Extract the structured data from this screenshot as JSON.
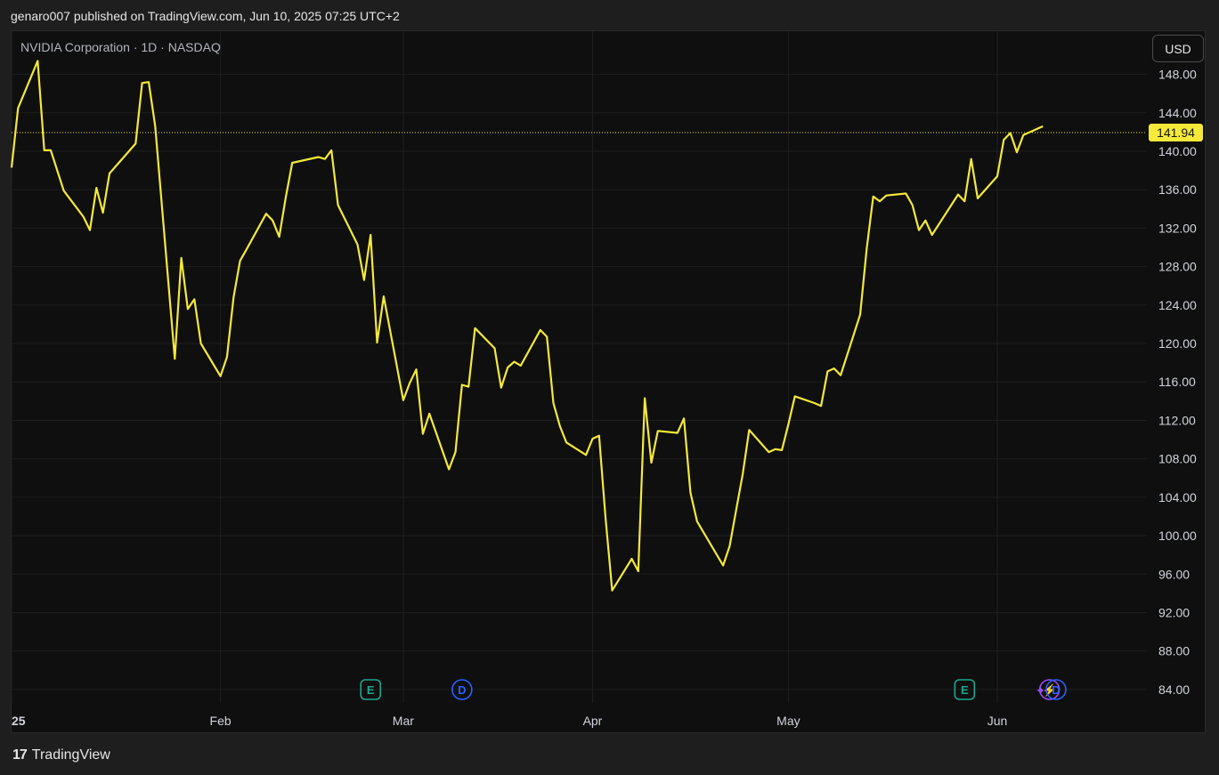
{
  "header": {
    "text": "genaro007 published on TradingView.com, Jun 10, 2025 07:25 UTC+2"
  },
  "symbol": {
    "text": "NVIDIA Corporation · 1D · NASDAQ"
  },
  "currency_button": {
    "label": "USD"
  },
  "footer": {
    "brand": "TradingView",
    "logo_glyph": "17"
  },
  "colors": {
    "line": "#f5e93a",
    "grid": "#1f1f1f",
    "background": "#0f0f0f",
    "axis_text": "#d1d4dc",
    "earnings": "#1fa68f",
    "dividend": "#2962ff",
    "split": "#9c4dff"
  },
  "chart_data": {
    "type": "line",
    "title": "",
    "xlabel": "",
    "ylabel": "",
    "ylim": [
      82.6,
      152.5
    ],
    "y_ticks": [
      84,
      88,
      92,
      96,
      100,
      104,
      108,
      112,
      116,
      120,
      124,
      128,
      132,
      136,
      140,
      144,
      148
    ],
    "y_tick_labels": [
      "84.00",
      "88.00",
      "92.00",
      "96.00",
      "100.00",
      "104.00",
      "108.00",
      "112.00",
      "116.00",
      "120.00",
      "124.00",
      "128.00",
      "132.00",
      "136.00",
      "140.00",
      "144.00",
      "148.00"
    ],
    "x_labels": [
      {
        "label": "25",
        "date": "2025-01-02"
      },
      {
        "label": "Feb",
        "date": "2025-02-03"
      },
      {
        "label": "Mar",
        "date": "2025-03-03"
      },
      {
        "label": "Apr",
        "date": "2025-04-01"
      },
      {
        "label": "May",
        "date": "2025-05-01"
      },
      {
        "label": "Jun",
        "date": "2025-06-02"
      }
    ],
    "last_price": 141.94,
    "last_price_label": "141.94",
    "series": [
      {
        "x": [
          "2025-01-02",
          "2025-01-03",
          "2025-01-06",
          "2025-01-07",
          "2025-01-08",
          "2025-01-10",
          "2025-01-13",
          "2025-01-14",
          "2025-01-15",
          "2025-01-16",
          "2025-01-17",
          "2025-01-21",
          "2025-01-22",
          "2025-01-23",
          "2025-01-24",
          "2025-01-27",
          "2025-01-28",
          "2025-01-29",
          "2025-01-30",
          "2025-01-31",
          "2025-02-03",
          "2025-02-04",
          "2025-02-05",
          "2025-02-06",
          "2025-02-07",
          "2025-02-10",
          "2025-02-11",
          "2025-02-12",
          "2025-02-13",
          "2025-02-14",
          "2025-02-18",
          "2025-02-19",
          "2025-02-20",
          "2025-02-21",
          "2025-02-24",
          "2025-02-25",
          "2025-02-26",
          "2025-02-27",
          "2025-02-28",
          "2025-03-03",
          "2025-03-04",
          "2025-03-05",
          "2025-03-06",
          "2025-03-07",
          "2025-03-10",
          "2025-03-11",
          "2025-03-12",
          "2025-03-13",
          "2025-03-14",
          "2025-03-17",
          "2025-03-18",
          "2025-03-19",
          "2025-03-20",
          "2025-03-21",
          "2025-03-24",
          "2025-03-25",
          "2025-03-26",
          "2025-03-27",
          "2025-03-28",
          "2025-03-31",
          "2025-04-01",
          "2025-04-02",
          "2025-04-03",
          "2025-04-04",
          "2025-04-07",
          "2025-04-08",
          "2025-04-09",
          "2025-04-10",
          "2025-04-11",
          "2025-04-14",
          "2025-04-15",
          "2025-04-16",
          "2025-04-17",
          "2025-04-21",
          "2025-04-22",
          "2025-04-23",
          "2025-04-24",
          "2025-04-25",
          "2025-04-28",
          "2025-04-29",
          "2025-04-30",
          "2025-05-01",
          "2025-05-02",
          "2025-05-05",
          "2025-05-06",
          "2025-05-07",
          "2025-05-08",
          "2025-05-09",
          "2025-05-12",
          "2025-05-13",
          "2025-05-14",
          "2025-05-15",
          "2025-05-16",
          "2025-05-19",
          "2025-05-20",
          "2025-05-21",
          "2025-05-22",
          "2025-05-23",
          "2025-05-27",
          "2025-05-28",
          "2025-05-29",
          "2025-05-30",
          "2025-06-02",
          "2025-06-03",
          "2025-06-04",
          "2025-06-05",
          "2025-06-06",
          "2025-06-09"
        ],
        "values": [
          138.3,
          144.5,
          149.4,
          140.1,
          140.1,
          135.9,
          133.2,
          131.8,
          136.2,
          133.6,
          137.7,
          140.8,
          147.1,
          147.2,
          142.6,
          118.4,
          128.9,
          123.6,
          124.6,
          120.0,
          116.6,
          118.6,
          124.8,
          128.6,
          129.8,
          133.5,
          132.8,
          131.1,
          135.2,
          138.8,
          139.4,
          139.2,
          140.1,
          134.4,
          130.3,
          126.6,
          131.3,
          120.1,
          124.9,
          114.1,
          115.9,
          117.3,
          110.6,
          112.7,
          106.9,
          108.7,
          115.7,
          115.5,
          121.6,
          119.5,
          115.4,
          117.5,
          118.1,
          117.7,
          121.4,
          120.7,
          113.8,
          111.4,
          109.7,
          108.4,
          110.1,
          110.4,
          101.8,
          94.3,
          97.6,
          96.3,
          114.3,
          107.6,
          110.9,
          110.7,
          112.2,
          104.5,
          101.5,
          96.9,
          98.9,
          102.7,
          106.4,
          111.0,
          108.7,
          109.0,
          108.9,
          111.6,
          114.5,
          113.8,
          113.5,
          117.1,
          117.4,
          116.7,
          123.0,
          129.9,
          135.3,
          134.8,
          135.4,
          135.6,
          134.4,
          131.8,
          132.8,
          131.3,
          135.5,
          134.8,
          139.2,
          135.1,
          137.4,
          141.2,
          141.9,
          139.9,
          141.7,
          142.6
        ]
      }
    ],
    "events": [
      {
        "type": "earnings",
        "label": "E",
        "date": "2025-02-26"
      },
      {
        "type": "dividend",
        "label": "D",
        "date": "2025-03-12"
      },
      {
        "type": "earnings",
        "label": "E",
        "date": "2025-05-28"
      },
      {
        "type": "split",
        "label": "⚡",
        "date": "2025-06-10"
      },
      {
        "type": "dividend",
        "label": "D",
        "date": "2025-06-11"
      }
    ],
    "grid": true,
    "legend": "none"
  }
}
